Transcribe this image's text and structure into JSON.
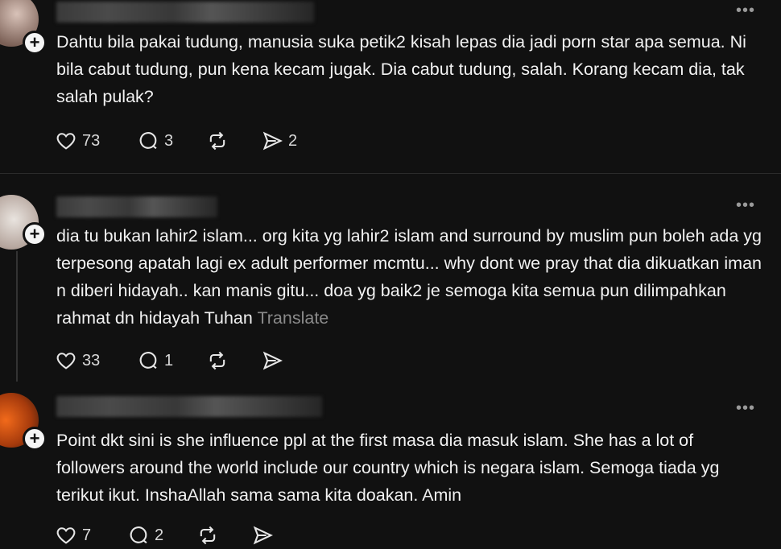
{
  "posts": [
    {
      "text": "Dahtu bila pakai tudung, manusia suka petik2 kisah lepas dia jadi porn star apa semua. Ni bila cabut tudung, pun kena kecam jugak. Dia cabut tudung, salah. Korang kecam dia, tak salah pulak?",
      "likes": "73",
      "replies": "3",
      "reposts": "",
      "shares": "2"
    },
    {
      "text": "dia tu bukan lahir2 islam... org kita yg lahir2 islam and surround by muslim pun boleh ada yg terpesong apatah lagi ex adult performer mcmtu... why dont we pray that dia dikuatkan iman n diberi hidayah.. kan manis gitu... doa yg baik2 je semoga kita semua pun dilimpahkan rahmat dn hidayah Tuhan",
      "translate": "Translate",
      "likes": "33",
      "replies": "1",
      "reposts": "",
      "shares": ""
    },
    {
      "text": "Point dkt sini is she influence ppl at the first masa dia masuk islam. She has a lot of followers around the world include our country which is negara islam. Semoga tiada yg terikut ikut. InshaAllah sama sama kita doakan. Amin",
      "likes": "7",
      "replies": "2",
      "reposts": "",
      "shares": ""
    }
  ],
  "more_glyph": "•••",
  "plus_glyph": "+",
  "icons": [
    "heart-icon",
    "comment-icon",
    "repost-icon",
    "share-icon",
    "more-icon",
    "follow-plus-icon"
  ],
  "colors": {
    "background": "#111111",
    "text": "#f2f2f2",
    "muted": "#8a8a8a",
    "icon": "#e6e6e6"
  }
}
